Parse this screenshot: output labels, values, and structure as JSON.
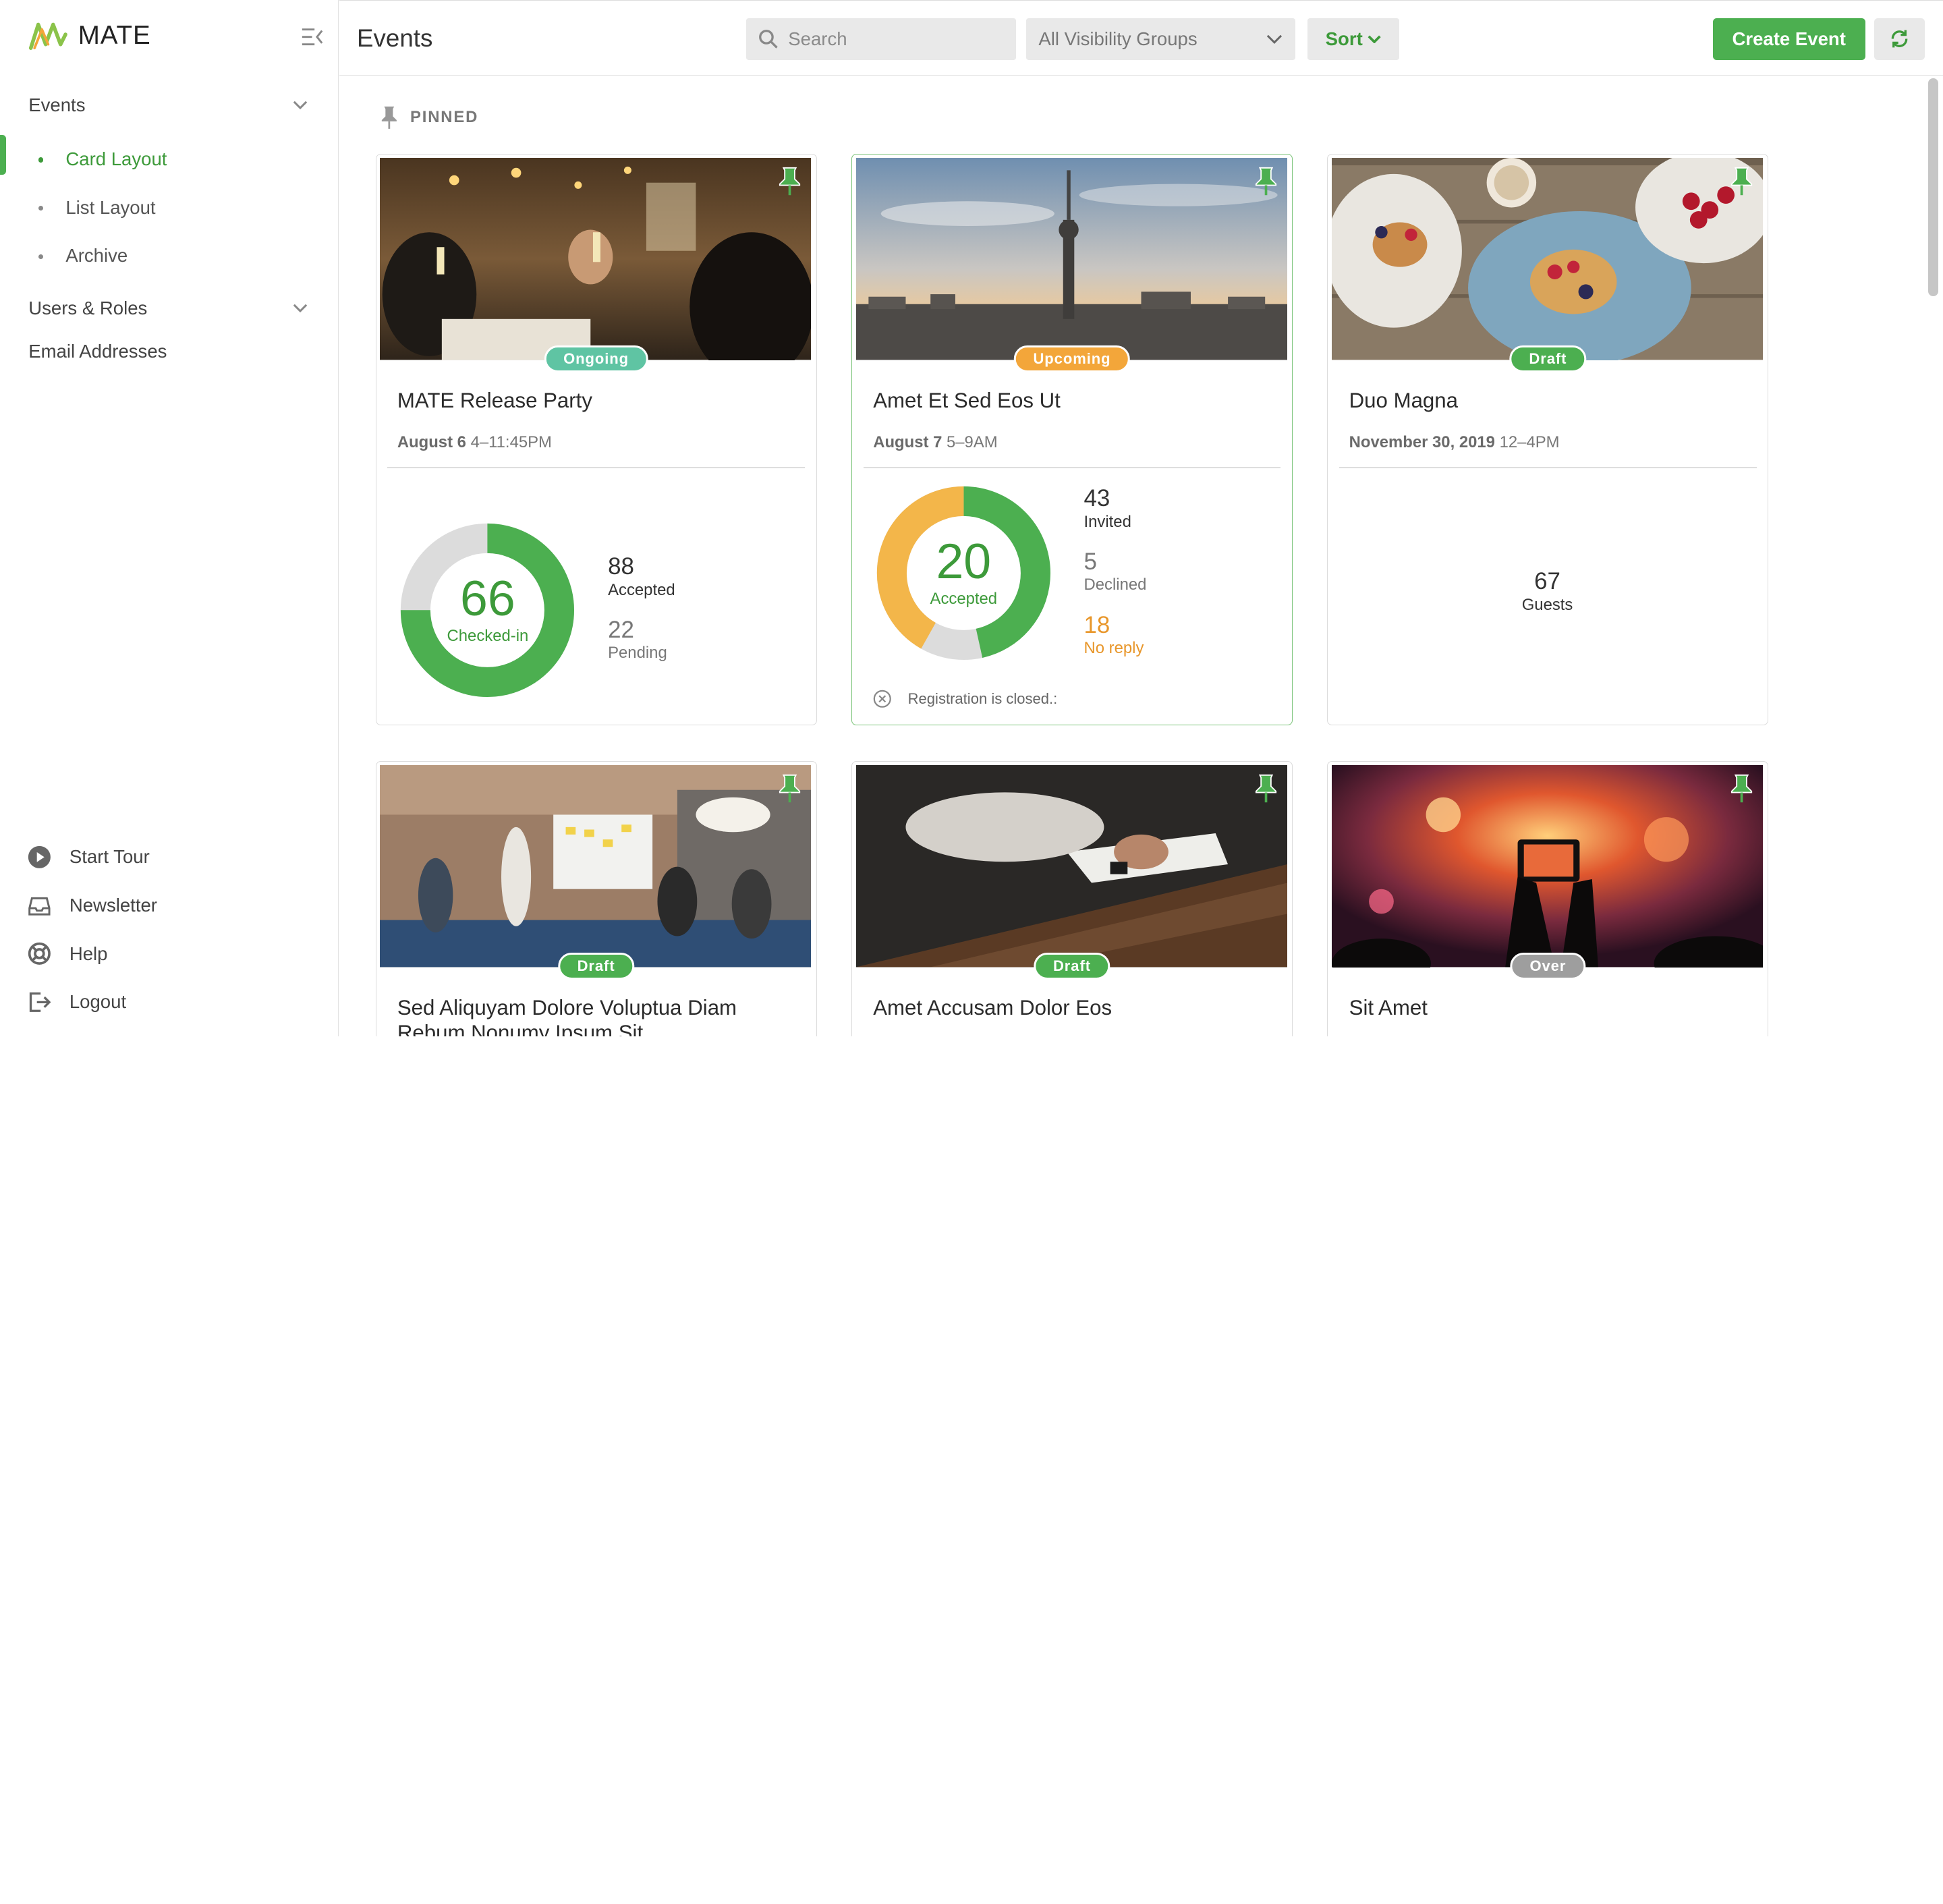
{
  "app": {
    "name": "MATE"
  },
  "sidebar": {
    "groups": [
      {
        "label": "Events",
        "items": [
          "Card Layout",
          "List Layout",
          "Archive"
        ]
      },
      {
        "label": "Users & Roles"
      }
    ],
    "single": "Email Addresses",
    "bottom": [
      "Start Tour",
      "Newsletter",
      "Help",
      "Logout"
    ]
  },
  "header": {
    "title": "Events",
    "search_placeholder": "Search",
    "visibility": "All Visibility Groups",
    "sort": "Sort",
    "create": "Create Event"
  },
  "content": {
    "pinned_label": "PINNED"
  },
  "colors": {
    "accent": "#4caf50",
    "accent_text": "#3d9a3a",
    "ongoing": "#5fc4a3",
    "upcoming": "#f3a63a",
    "over": "#9e9e9e"
  },
  "cards": [
    {
      "title": "MATE Release Party",
      "badge": "Ongoing",
      "date_bold": "August 6",
      "time": "4–11:45PM",
      "donut_value": "66",
      "donut_label": "Checked-in",
      "donut_fraction": 0.75,
      "stat1_value": "88",
      "stat1_label": "Accepted",
      "stat2_value": "22",
      "stat2_label": "Pending"
    },
    {
      "title": "Amet Et Sed Eos Ut",
      "badge": "Upcoming",
      "date_bold": "August 7",
      "time": "5–9AM",
      "donut_value": "20",
      "donut_label": "Accepted",
      "donut_segments": {
        "accepted": 20,
        "declined": 5,
        "no_reply": 18
      },
      "stat1_value": "43",
      "stat1_label": "Invited",
      "stat2_value": "5",
      "stat2_label": "Declined",
      "stat3_value": "18",
      "stat3_label": "No reply",
      "registration": "Registration is closed.:"
    },
    {
      "title": "Duo Magna",
      "badge": "Draft",
      "date_bold": "November 30, 2019",
      "time": "12–4PM",
      "guests_value": "67",
      "guests_label": "Guests"
    },
    {
      "title": "Sed Aliquyam Dolore Voluptua Diam Rebum Nonumy Ipsum Sit",
      "badge": "Draft"
    },
    {
      "title": "Amet Accusam Dolor Eos",
      "badge": "Draft"
    },
    {
      "title": "Sit Amet",
      "badge": "Over"
    }
  ]
}
